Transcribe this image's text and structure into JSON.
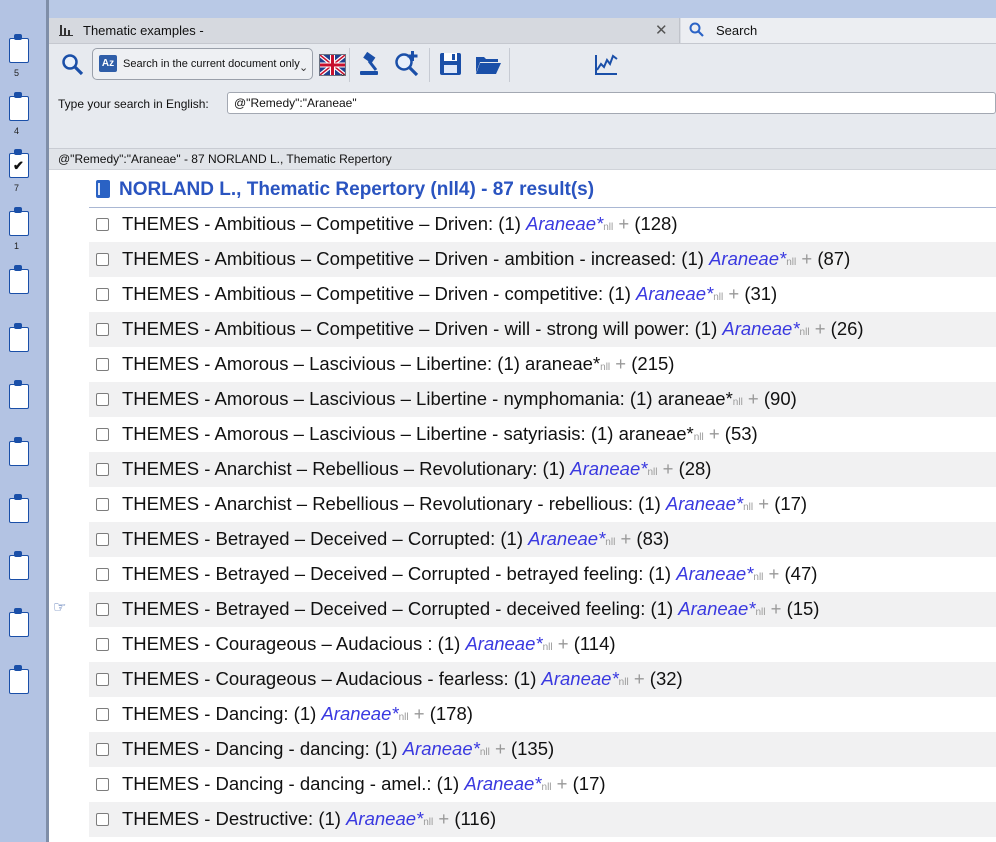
{
  "clipboards": [
    {
      "num": "5",
      "checked": false
    },
    {
      "num": "4",
      "checked": false
    },
    {
      "num": "7",
      "checked": true
    },
    {
      "num": "1",
      "checked": false
    },
    {
      "num": "",
      "checked": false
    },
    {
      "num": "",
      "checked": false
    },
    {
      "num": "",
      "checked": false
    },
    {
      "num": "",
      "checked": false
    },
    {
      "num": "",
      "checked": false
    },
    {
      "num": "",
      "checked": false
    },
    {
      "num": "",
      "checked": false
    },
    {
      "num": "",
      "checked": false
    }
  ],
  "tabs": {
    "doc_title": "Thematic examples -",
    "search_title": "Search"
  },
  "toolbar": {
    "mode_label": "Search in the current document only"
  },
  "search": {
    "label": "Type your search in English:",
    "value": "@\"Remedy\":\"Araneae\""
  },
  "status": "@\"Remedy\":\"Araneae\" - 87 NORLAND L., Thematic Repertory",
  "results": {
    "header": "NORLAND L., Thematic Repertory (nll4) - 87 result(s)",
    "rows": [
      {
        "rubric": "THEMES - Ambitious – Competitive – Driven: (1) ",
        "remedy": "Araneae*",
        "italic": true,
        "src": "nll",
        "plus": " + ",
        "count": "(128)"
      },
      {
        "rubric": "THEMES - Ambitious – Competitive – Driven - ambition - increased: (1) ",
        "remedy": "Araneae*",
        "italic": true,
        "src": "nll",
        "plus": " + ",
        "count": "(87)"
      },
      {
        "rubric": "THEMES - Ambitious – Competitive – Driven - competitive: (1) ",
        "remedy": "Araneae*",
        "italic": true,
        "src": "nll",
        "plus": " + ",
        "count": "(31)"
      },
      {
        "rubric": "THEMES - Ambitious – Competitive – Driven - will - strong will power: (1) ",
        "remedy": "Araneae*",
        "italic": true,
        "src": "nll",
        "plus": " + ",
        "count": "(26)"
      },
      {
        "rubric": "THEMES - Amorous – Lascivious – Libertine: (1) ",
        "remedy": "araneae*",
        "italic": false,
        "src": "nll",
        "plus": " + ",
        "count": "(215)"
      },
      {
        "rubric": "THEMES - Amorous – Lascivious – Libertine - nymphomania: (1) ",
        "remedy": "araneae*",
        "italic": false,
        "src": "nll",
        "plus": " + ",
        "count": "(90)"
      },
      {
        "rubric": "THEMES - Amorous – Lascivious – Libertine - satyriasis: (1) ",
        "remedy": "araneae*",
        "italic": false,
        "src": "nll",
        "plus": " + ",
        "count": "(53)"
      },
      {
        "rubric": "THEMES - Anarchist – Rebellious – Revolutionary: (1) ",
        "remedy": "Araneae*",
        "italic": true,
        "src": "nll",
        "plus": " + ",
        "count": "(28)"
      },
      {
        "rubric": "THEMES - Anarchist – Rebellious – Revolutionary - rebellious: (1) ",
        "remedy": "Araneae*",
        "italic": true,
        "src": "nll",
        "plus": " + ",
        "count": "(17)"
      },
      {
        "rubric": "THEMES - Betrayed – Deceived – Corrupted: (1) ",
        "remedy": "Araneae*",
        "italic": true,
        "src": "nll",
        "plus": " + ",
        "count": "(83)"
      },
      {
        "rubric": "THEMES - Betrayed – Deceived – Corrupted - betrayed feeling: (1) ",
        "remedy": "Araneae*",
        "italic": true,
        "src": "nll",
        "plus": " + ",
        "count": "(47)"
      },
      {
        "rubric": "THEMES - Betrayed – Deceived – Corrupted - deceived feeling: (1) ",
        "remedy": "Araneae*",
        "italic": true,
        "src": "nll",
        "plus": " + ",
        "count": "(15)"
      },
      {
        "rubric": "THEMES - Courageous – Audacious : (1) ",
        "remedy": "Araneae*",
        "italic": true,
        "src": "nll",
        "plus": " + ",
        "count": "(114)"
      },
      {
        "rubric": "THEMES - Courageous – Audacious  - fearless: (1) ",
        "remedy": "Araneae*",
        "italic": true,
        "src": "nll",
        "plus": " + ",
        "count": "(32)"
      },
      {
        "rubric": "THEMES - Dancing: (1) ",
        "remedy": "Araneae*",
        "italic": true,
        "src": "nll",
        "plus": " + ",
        "count": "(178)"
      },
      {
        "rubric": "THEMES - Dancing - dancing: (1) ",
        "remedy": "Araneae*",
        "italic": true,
        "src": "nll",
        "plus": " + ",
        "count": "(135)"
      },
      {
        "rubric": "THEMES - Dancing - dancing - amel.: (1) ",
        "remedy": "Araneae*",
        "italic": true,
        "src": "nll",
        "plus": " + ",
        "count": "(17)"
      },
      {
        "rubric": "THEMES - Destructive: (1) ",
        "remedy": "Araneae*",
        "italic": true,
        "src": "nll",
        "plus": " + ",
        "count": "(116)"
      }
    ]
  },
  "colors": {
    "accent": "#2a54c0",
    "remedy": "#3a39e0",
    "sidebar": "#b3c3e3"
  }
}
